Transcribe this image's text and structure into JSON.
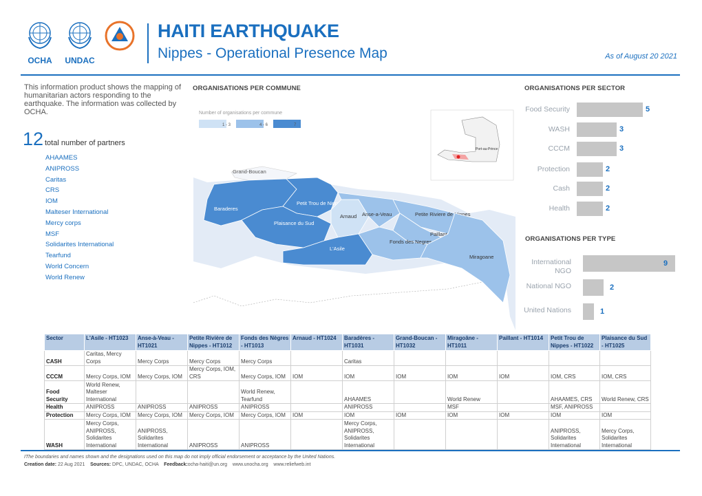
{
  "header": {
    "logos": [
      "OCHA",
      "UNDAC"
    ],
    "title": "HAITI EARTHQUAKE",
    "subtitle": "Nippes - Operational Presence Map",
    "date": "As  of August 20 2021"
  },
  "intro": {
    "text": "This information product shows the mapping of humanitarian actors responding to the earthquake. The information was collected by OCHA.",
    "partner_count": "12",
    "partner_label": "total number of partners",
    "partners": [
      "AHAAMES",
      "ANIPROSS",
      "Caritas",
      "CRS",
      "IOM",
      "Malteser International",
      "Mercy corps",
      "MSF",
      "Solidarites International",
      "Tearfund",
      "World Concern",
      "World Renew"
    ]
  },
  "map": {
    "heading": "ORGANISATIONS PER COMMUNE",
    "legend_title": "Number of organisations per commune",
    "legend": [
      {
        "label": "1 - 3",
        "color": "#cfe2f5"
      },
      {
        "label": "4 - 6",
        "color": "#9cc2ea"
      },
      {
        "label": "7",
        "color": "#4a8bd1"
      }
    ],
    "inset_label": "Port-au-Prince",
    "communes": [
      {
        "name": "Grand-Boucan",
        "class": "none"
      },
      {
        "name": "Baraderes",
        "class": "7"
      },
      {
        "name": "Petit Trou de Nippes",
        "class": "7"
      },
      {
        "name": "Arnaud",
        "class": "1-3"
      },
      {
        "name": "Anse-a-Veau",
        "class": "4-6"
      },
      {
        "name": "Petite Riviere de Nippes",
        "class": "4-6"
      },
      {
        "name": "Plaisance du Sud",
        "class": "7"
      },
      {
        "name": "Paillant",
        "class": "4-6"
      },
      {
        "name": "Fonds des Negres",
        "class": "4-6"
      },
      {
        "name": "L'Asile",
        "class": "7"
      },
      {
        "name": "Miragoane",
        "class": "4-6"
      }
    ]
  },
  "sectors": {
    "heading": "ORGANISATIONS PER SECTOR",
    "items": [
      {
        "label": "Food Security",
        "value": 5
      },
      {
        "label": "WASH",
        "value": 3
      },
      {
        "label": "CCCM",
        "value": 3
      },
      {
        "label": "Protection",
        "value": 2
      },
      {
        "label": "Cash",
        "value": 2
      },
      {
        "label": "Health",
        "value": 2
      }
    ]
  },
  "types": {
    "heading": "ORGANISATIONS PER TYPE",
    "items": [
      {
        "label": "International NGO",
        "value": 9
      },
      {
        "label": "National NGO",
        "value": 2
      },
      {
        "label": "United Nations",
        "value": 1
      }
    ]
  },
  "table": {
    "headers": [
      "Sector",
      "L'Asile - HT1023",
      "Anse-à-Veau - HT1021",
      "Petite Rivière de Nippes - HT1012",
      "Fonds des Nègres - HT1013",
      "Arnaud - HT1024",
      "Baradères - HT1031",
      "Grand-Boucan - HT1032",
      "Miragoâne - HT1011",
      "Paillant - HT1014",
      "Petit Trou de Nippes - HT1022",
      "Plaisance du Sud - HT1025"
    ],
    "rows": [
      [
        "CASH",
        "Caritas, Mercy Corps",
        "Mercy Corps",
        "Mercy Corps",
        "Mercy Corps",
        "",
        "Caritas",
        "",
        "",
        "",
        "",
        ""
      ],
      [
        "CCCM",
        "Mercy Corps, IOM",
        "Mercy Corps, IOM",
        "Mercy Corps, IOM, CRS",
        "Mercy Corps, IOM",
        "IOM",
        "IOM",
        "IOM",
        "IOM",
        "IOM",
        "IOM, CRS",
        "IOM, CRS"
      ],
      [
        "Food Security",
        "World Renew, Malteser International",
        "",
        "",
        "World Renew, Tearfund",
        "",
        "AHAAMES",
        "",
        "World Renew",
        "",
        "AHAAMES, CRS",
        "World Renew, CRS"
      ],
      [
        "Health",
        "ANIPROSS",
        "ANIPROSS",
        "ANIPROSS",
        "ANIPROSS",
        "",
        "ANIPROSS",
        "",
        "MSF",
        "",
        "MSF, ANIPROSS",
        ""
      ],
      [
        "Protection",
        "Mercy Corps, IOM",
        "Mercy Corps, IOM",
        "Mercy Corps, IOM",
        "Mercy Corps, IOM",
        "IOM",
        "IOM",
        "IOM",
        "IOM",
        "IOM",
        "IOM",
        "IOM"
      ],
      [
        "WASH",
        "Mercy Corps, ANIPROSS, Solidarites International",
        "ANIPROSS, Solidarites International",
        "ANIPROSS",
        "ANIPROSS",
        "",
        "Mercy Corps, ANIPROSS, Solidarites International",
        "",
        "",
        "",
        "ANIPROSS, Solidarites International",
        "Mercy Corps, Solidarites International"
      ]
    ]
  },
  "footer": {
    "disclaimer": "IThe boundaries and names shown and the designations used on this map do not imply official endorsement or acceptance by the United Nations.",
    "creation_label": "Creation date:",
    "creation_value": "22 Aug 2021",
    "sources_label": "Sources:",
    "sources_value": "DPC, UNDAC, OCHA",
    "feedback_label": "Feedback:",
    "feedback_value": "ocha-haiti@un.org",
    "web1": "www.unocha.org",
    "web2": "www.reliefweb.int"
  }
}
